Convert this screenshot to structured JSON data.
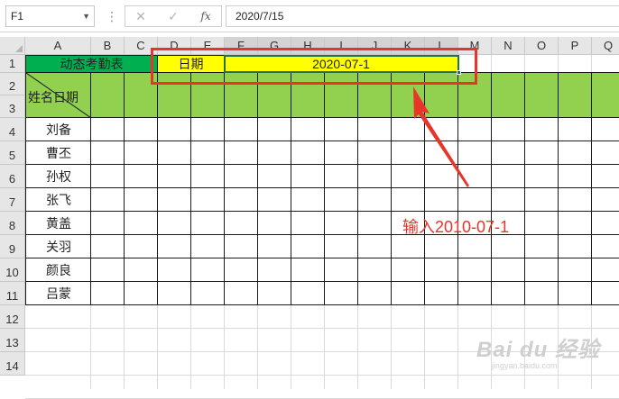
{
  "formula_bar": {
    "name_box": "F1",
    "cancel_icon": "✕",
    "enter_icon": "✓",
    "fx_label": "fx",
    "formula": "2020/7/15"
  },
  "columns": [
    "A",
    "B",
    "C",
    "D",
    "E",
    "F",
    "G",
    "H",
    "I",
    "J",
    "K",
    "L",
    "M",
    "N",
    "O",
    "P",
    "Q"
  ],
  "rows": [
    "1",
    "2",
    "3",
    "4",
    "5",
    "6",
    "7",
    "8",
    "9",
    "10",
    "11",
    "12",
    "13",
    "14"
  ],
  "table": {
    "title": "动态考勤表",
    "date_label": "日期",
    "date_value": "2020-07-1",
    "header_name": "姓名",
    "header_date": "日期",
    "names": [
      "刘备",
      "曹丕",
      "孙权",
      "张飞",
      "黄盖",
      "关羽",
      "颜良",
      "吕蒙"
    ]
  },
  "annotation": {
    "text": "输入2010-07-1"
  },
  "watermark": {
    "brand": "Bai du 经验",
    "url": "jingyan.baidu.com"
  },
  "colors": {
    "title_fill": "#00b050",
    "date_fill": "#ffff00",
    "header_fill": "#92d050",
    "annotation": "#e8352a"
  }
}
